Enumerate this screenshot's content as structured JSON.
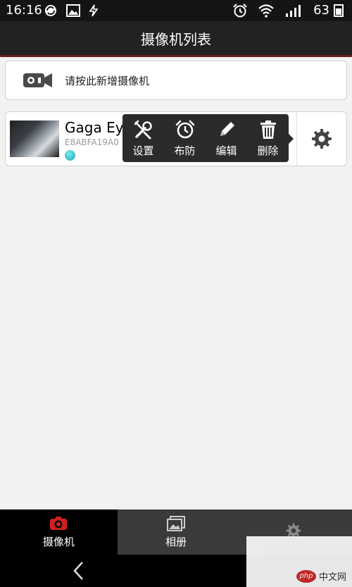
{
  "status_bar": {
    "time": "16:16",
    "battery": "63"
  },
  "header": {
    "title": "摄像机列表"
  },
  "add_camera": {
    "label": "请按此新增摄像机"
  },
  "camera": {
    "name": "Gaga Eye",
    "id": "E8ABFA19A0"
  },
  "popup": {
    "actions": [
      {
        "label": "设置",
        "icon": "wrench-icon"
      },
      {
        "label": "布防",
        "icon": "alarm-clock-icon"
      },
      {
        "label": "编辑",
        "icon": "pencil-icon"
      },
      {
        "label": "删除",
        "icon": "trash-icon"
      }
    ]
  },
  "bottom_nav": {
    "tabs": [
      {
        "label": "摄像机",
        "icon": "camera-icon"
      },
      {
        "label": "相册",
        "icon": "gallery-icon"
      },
      {
        "label": "",
        "icon": "gear-icon"
      }
    ]
  },
  "watermark": {
    "logo_text": "php",
    "text": "中文网"
  },
  "colors": {
    "accent_red": "#d11f1f",
    "status_dot": "#17aab8",
    "title_bar_bg": "#222222"
  }
}
